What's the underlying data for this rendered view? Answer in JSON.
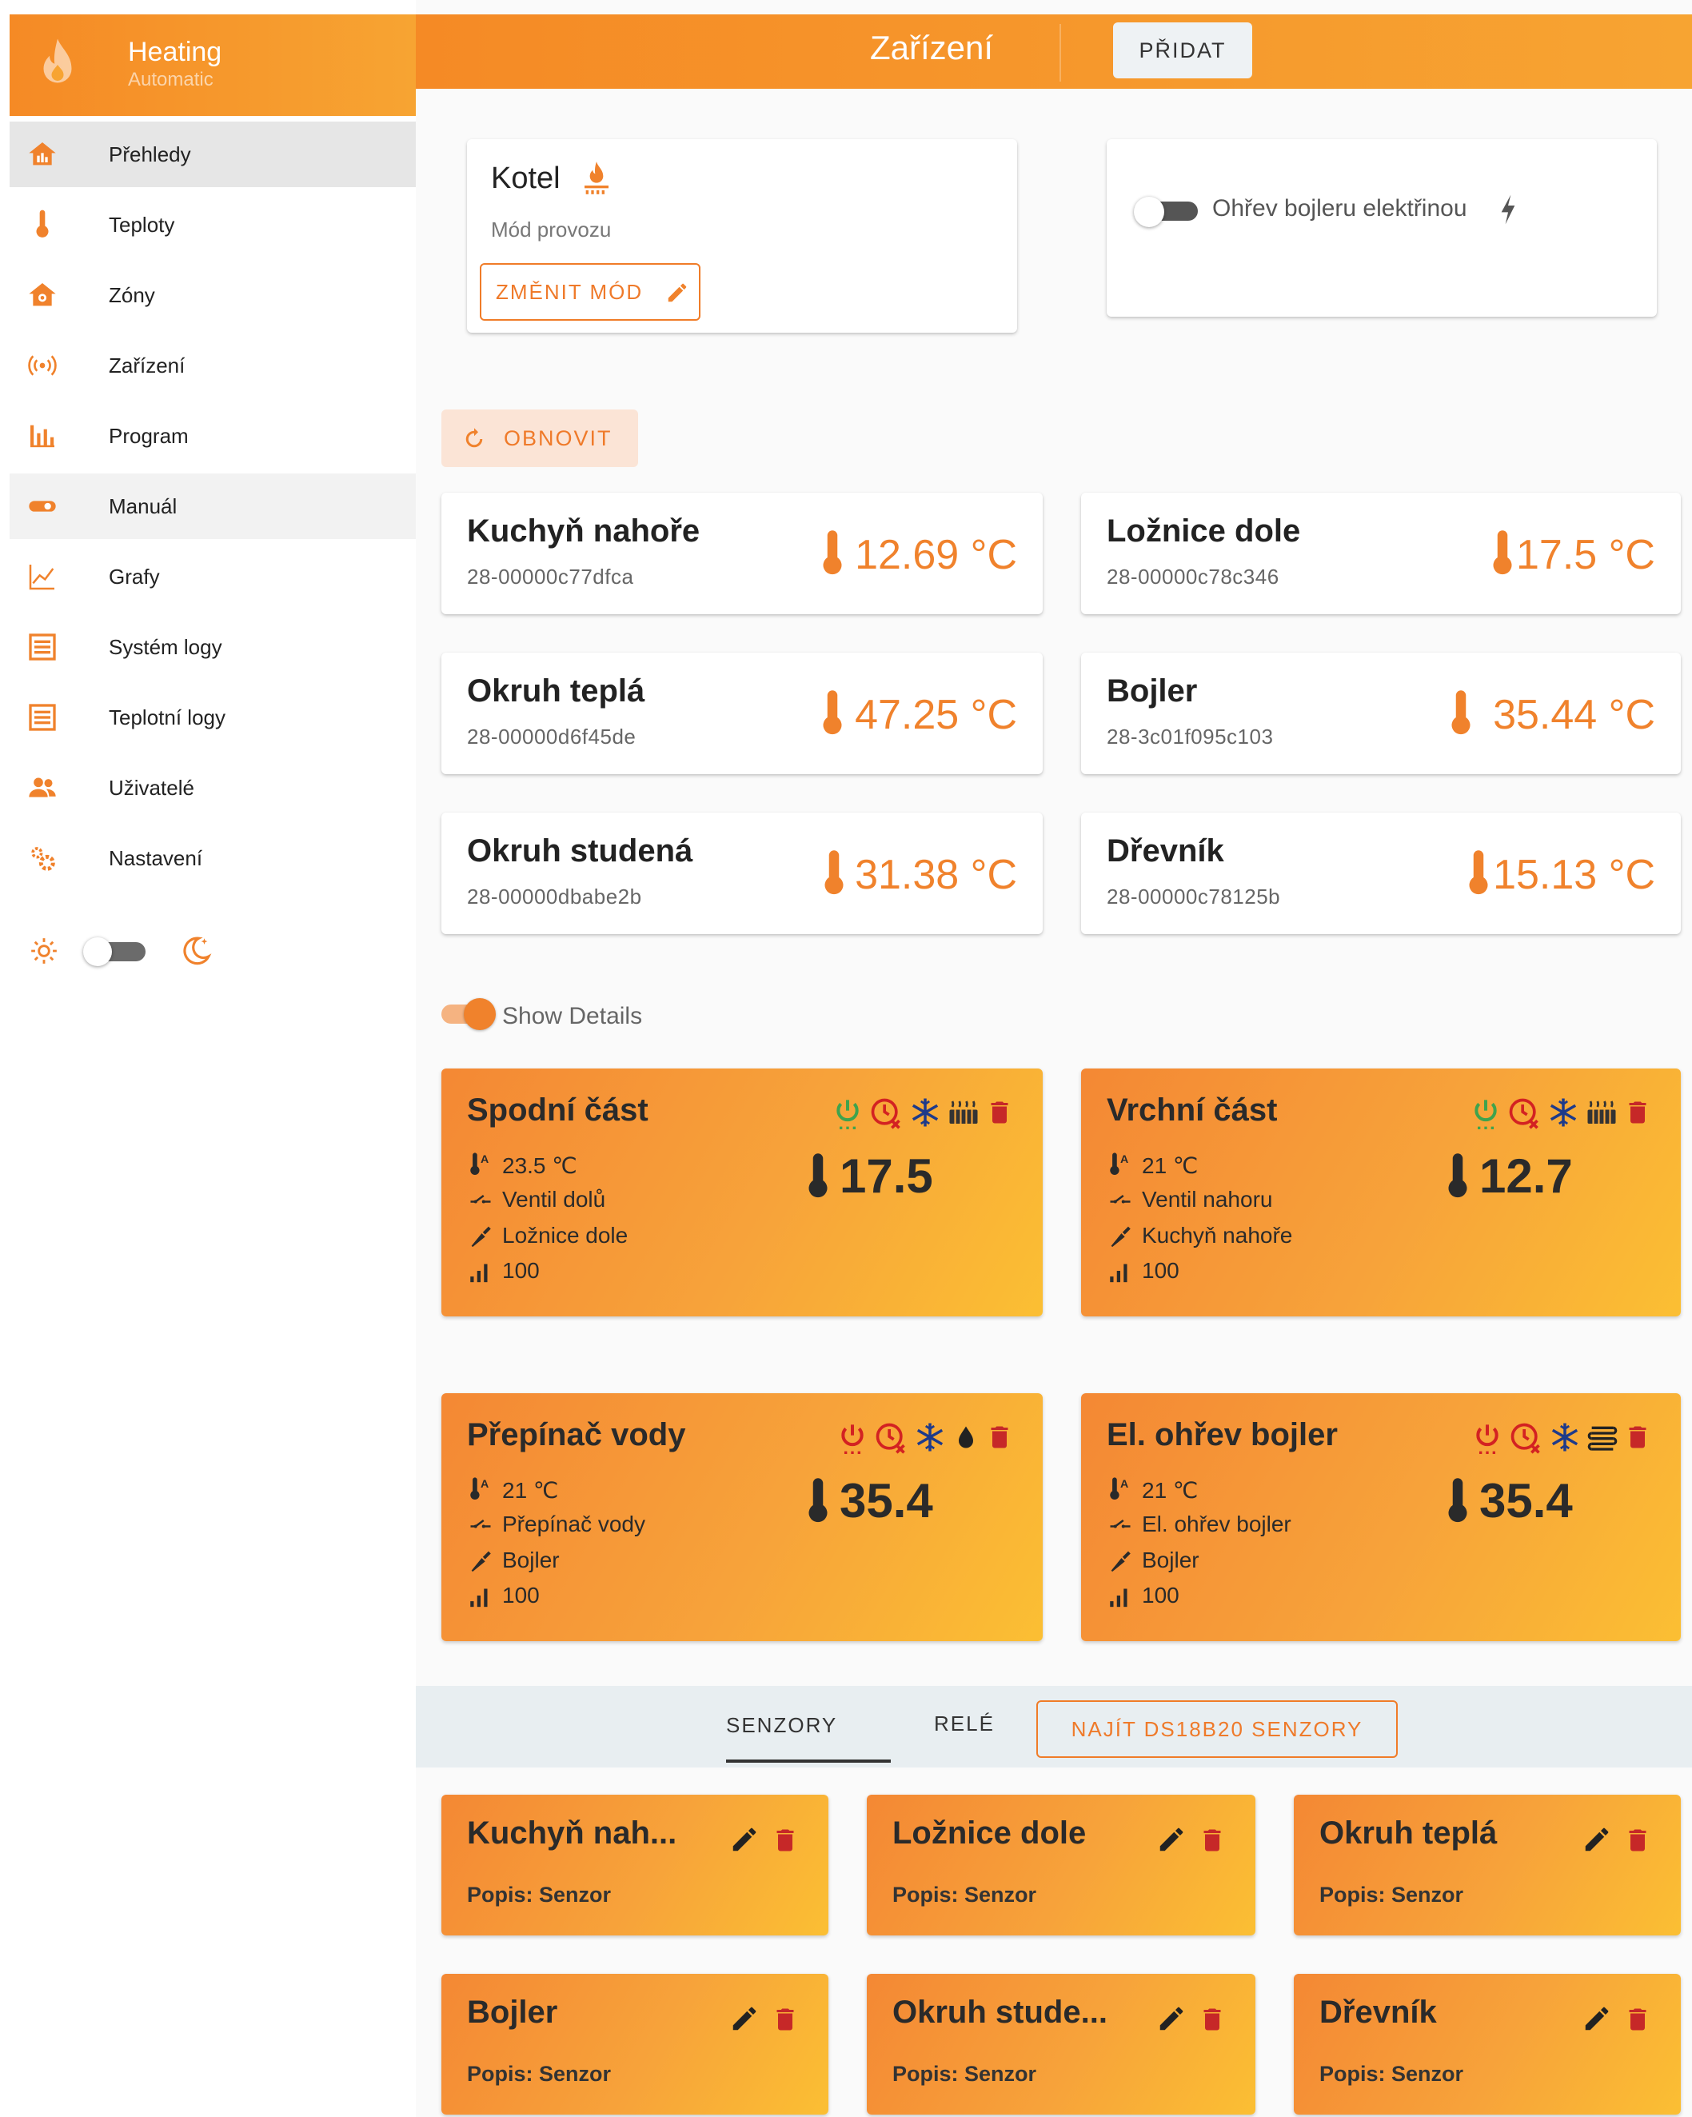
{
  "sidebar": {
    "brand_title": "Heating",
    "brand_subtitle": "Automatic",
    "items": [
      {
        "label": "Přehledy",
        "icon": "home-chart-icon"
      },
      {
        "label": "Teploty",
        "icon": "thermometer-icon"
      },
      {
        "label": "Zóny",
        "icon": "zone-home-icon"
      },
      {
        "label": "Zařízení",
        "icon": "wireless-icon"
      },
      {
        "label": "Program",
        "icon": "bar-chart-icon"
      },
      {
        "label": "Manuál",
        "icon": "toggle-icon"
      },
      {
        "label": "Grafy",
        "icon": "line-chart-icon"
      },
      {
        "label": "Systém logy",
        "icon": "log-list-icon"
      },
      {
        "label": "Teplotní logy",
        "icon": "log-list-icon"
      },
      {
        "label": "Uživatelé",
        "icon": "users-icon"
      },
      {
        "label": "Nastavení",
        "icon": "gears-icon"
      }
    ]
  },
  "header": {
    "title": "Zařízení",
    "add_label": "PŘIDAT"
  },
  "boiler": {
    "name": "Kotel",
    "mode_label": "Mód provozu",
    "change_mode_label": "ZMĚNIT MÓD"
  },
  "electric": {
    "label": "Ohřev bojleru elektřinou",
    "enabled": false
  },
  "refresh_label": "OBNOVIT",
  "temperatures": [
    {
      "name": "Kuchyň nahoře",
      "addr": "28-00000c77dfca",
      "value": "12.69 °C"
    },
    {
      "name": "Ložnice dole",
      "addr": "28-00000c78c346",
      "value": "17.5 °C"
    },
    {
      "name": "Okruh teplá",
      "addr": "28-00000d6f45de",
      "value": "47.25 °C"
    },
    {
      "name": "Bojler",
      "addr": "28-3c01f095c103",
      "value": "35.44 °C"
    },
    {
      "name": "Okruh studená",
      "addr": "28-00000dbabe2b",
      "value": "31.38 °C"
    },
    {
      "name": "Dřevník",
      "addr": "28-00000c78125b",
      "value": "15.13 °C"
    }
  ],
  "show_details_label": "Show Details",
  "zones": [
    {
      "name": "Spodní část",
      "target": "23.5 ℃",
      "relay": "Ventil dolů",
      "sensor": "Ložnice dole",
      "level": "100",
      "current": "17.5",
      "power_color": "#3fa34d",
      "mode_icon": "heater-icon"
    },
    {
      "name": "Vrchní část",
      "target": "21 ℃",
      "relay": "Ventil nahoru",
      "sensor": "Kuchyň nahoře",
      "level": "100",
      "current": "12.7",
      "power_color": "#3fa34d",
      "mode_icon": "heater-icon"
    },
    {
      "name": "Přepínač vody",
      "target": "21 ℃",
      "relay": "Přepínač vody",
      "sensor": "Bojler",
      "level": "100",
      "current": "35.4",
      "power_color": "#d32222",
      "mode_icon": "drop-icon"
    },
    {
      "name": "El. ohřev bojler",
      "target": "21 ℃",
      "relay": "El. ohřev bojler",
      "sensor": "Bojler",
      "level": "100",
      "current": "35.4",
      "power_color": "#d32222",
      "mode_icon": "coil-icon"
    }
  ],
  "tabs": {
    "senzory": "SENZORY",
    "rele": "RELÉ",
    "find": "NAJÍT DS18B20 SENZORY"
  },
  "sensors": [
    {
      "name": "Kuchyň nah...",
      "desc": "Popis: Senzor"
    },
    {
      "name": "Ložnice dole",
      "desc": "Popis: Senzor"
    },
    {
      "name": "Okruh teplá",
      "desc": "Popis: Senzor"
    },
    {
      "name": "Bojler",
      "desc": "Popis: Senzor"
    },
    {
      "name": "Okruh stude...",
      "desc": "Popis: Senzor"
    },
    {
      "name": "Dřevník",
      "desc": "Popis: Senzor"
    }
  ],
  "colors": {
    "accent": "#f0822c",
    "danger": "#c62828"
  }
}
